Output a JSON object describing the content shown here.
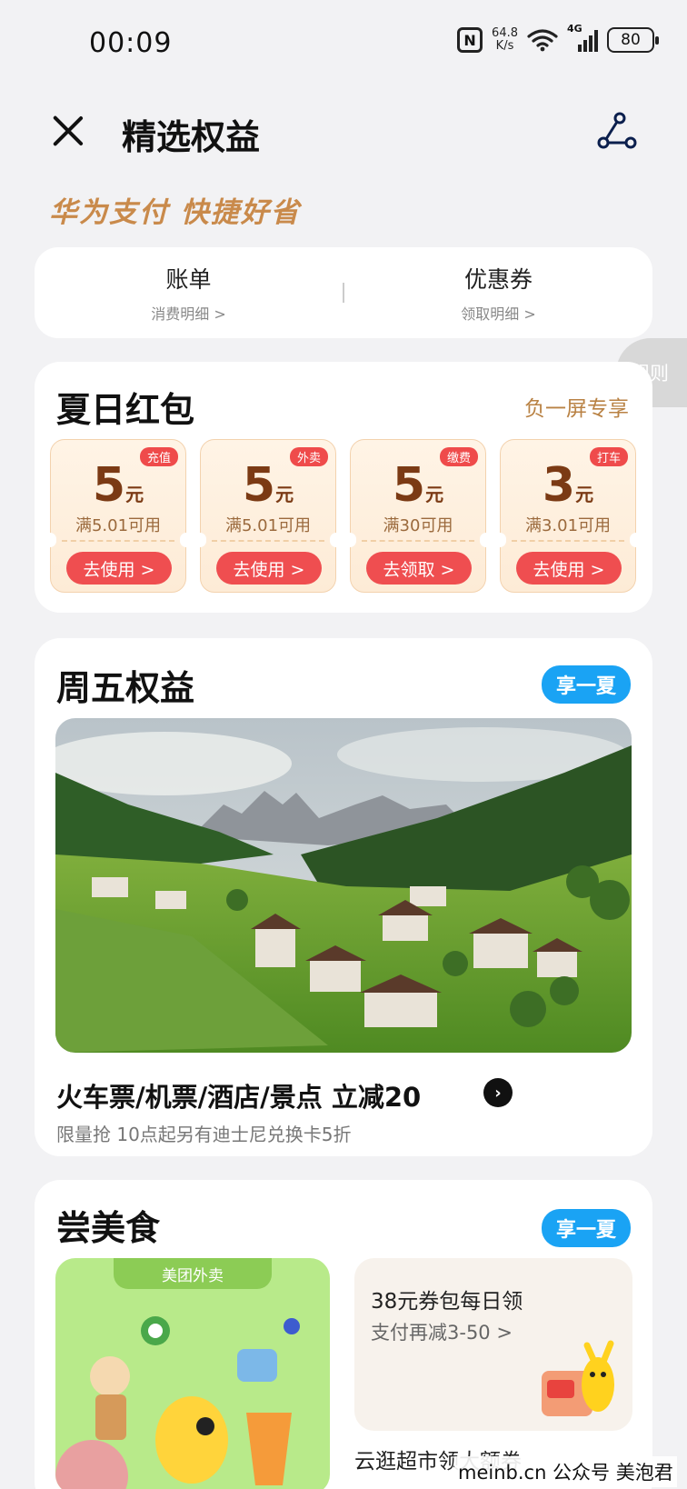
{
  "status_bar": {
    "time": "00:09",
    "net_speed_value": "64.8",
    "net_speed_unit": "K/s",
    "network_type": "4G",
    "battery": "80"
  },
  "header": {
    "title": "精选权益"
  },
  "slogan": "华为支付 快捷好省",
  "nav_card": {
    "bill_label": "账单",
    "bill_sub": "消费明细 >",
    "coupon_label": "优惠券",
    "coupon_sub": "领取明细 >"
  },
  "rules_tab": "规则",
  "summer": {
    "title": "夏日红包",
    "tag": "负一屏专享",
    "coupons": [
      {
        "badge": "充值",
        "amount": "5",
        "unit": "元",
        "condition": "满5.01可用",
        "button": "去使用 >"
      },
      {
        "badge": "外卖",
        "amount": "5",
        "unit": "元",
        "condition": "满5.01可用",
        "button": "去使用 >"
      },
      {
        "badge": "缴费",
        "amount": "5",
        "unit": "元",
        "condition": "满30可用",
        "button": "去领取 >"
      },
      {
        "badge": "打车",
        "amount": "3",
        "unit": "元",
        "condition": "满3.01可用",
        "button": "去使用 >"
      }
    ]
  },
  "friday": {
    "title": "周五权益",
    "pill": "享一夏",
    "promo_title": "火车票/机票/酒店/景点 立减20",
    "promo_sub": "限量抢 10点起另有迪士尼兑换卡5折"
  },
  "food": {
    "title": "尝美食",
    "pill": "享一夏",
    "meituan_label": "美团外卖",
    "card1_title": "38元券包每日领",
    "card1_sub": "支付再减3-50 >",
    "card2_title": "云逛超市领大额券"
  },
  "watermark": "meinb.cn  公众号 美泡君",
  "colors": {
    "accent_red": "#ef4e50",
    "accent_blue": "#1aa3f4",
    "gold": "#c98a4b"
  }
}
